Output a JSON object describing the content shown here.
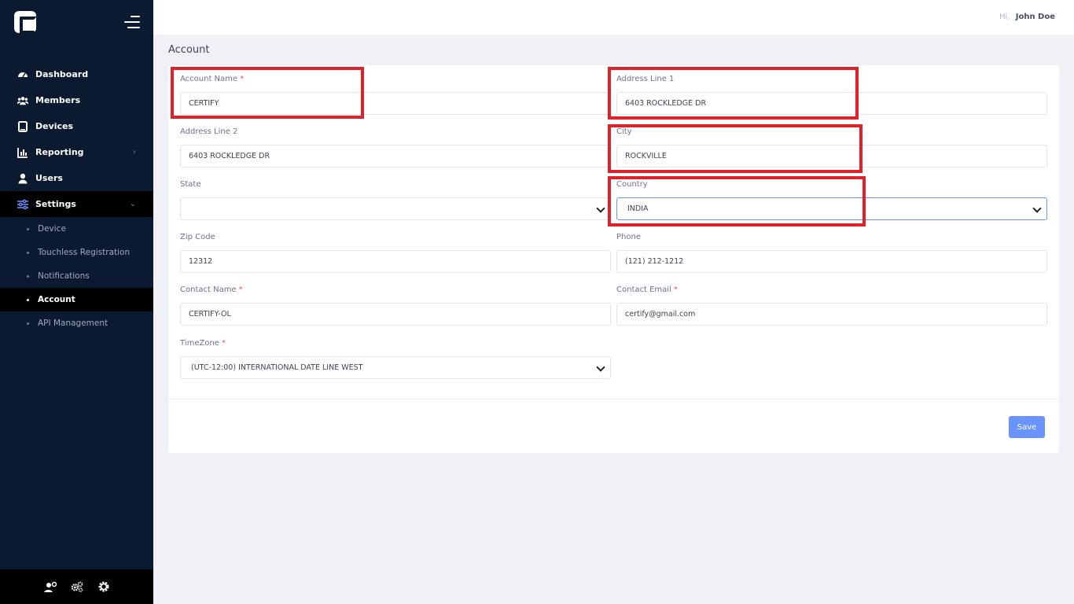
{
  "header": {
    "greeting": "Hi,",
    "user_name": "John Doe"
  },
  "sidebar": {
    "items": [
      {
        "label": "Dashboard",
        "icon": "dashboard-icon"
      },
      {
        "label": "Members",
        "icon": "members-icon"
      },
      {
        "label": "Devices",
        "icon": "tablet-icon"
      },
      {
        "label": "Reporting",
        "icon": "chart-icon",
        "caret": "›"
      },
      {
        "label": "Users",
        "icon": "user-icon"
      },
      {
        "label": "Settings",
        "icon": "sliders-icon",
        "caret": "⌄"
      }
    ],
    "sub_items": [
      {
        "label": "Device"
      },
      {
        "label": "Touchless Registration"
      },
      {
        "label": "Notifications"
      },
      {
        "label": "Account"
      },
      {
        "label": "API Management"
      }
    ]
  },
  "page": {
    "title": "Account"
  },
  "form": {
    "account_name": {
      "label": "Account Name",
      "required": "*",
      "value": "CERTIFY"
    },
    "address_line_1": {
      "label": "Address Line 1",
      "value": "6403 ROCKLEDGE DR"
    },
    "address_line_2": {
      "label": "Address Line 2",
      "value": "6403 ROCKLEDGE DR"
    },
    "city": {
      "label": "City",
      "value": "ROCKVILLE"
    },
    "state": {
      "label": "State",
      "value": ""
    },
    "country": {
      "label": "Country",
      "value": "INDIA"
    },
    "zip_code": {
      "label": "Zip Code",
      "value": "12312"
    },
    "phone": {
      "label": "Phone",
      "value": "(121) 212-1212"
    },
    "contact_name": {
      "label": "Contact Name",
      "required": "*",
      "value": "CERTIFY-OL"
    },
    "contact_email": {
      "label": "Contact Email",
      "required": "*",
      "value": "certify@gmail.com"
    },
    "timezone": {
      "label": "TimeZone",
      "required": "*",
      "value": "(UTC-12:00) INTERNATIONAL DATE LINE WEST"
    },
    "save_label": "Save"
  },
  "colors": {
    "sidebar_bg": "#0b1a30",
    "accent": "#6993ff",
    "highlight": "#e0212a",
    "required": "#f64e60"
  }
}
